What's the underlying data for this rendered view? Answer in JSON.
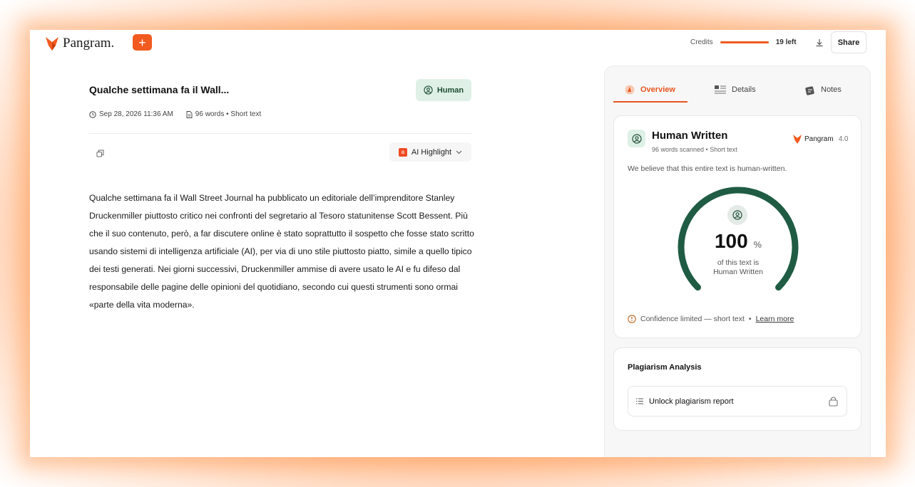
{
  "app": {
    "brand": "Pangram.",
    "new_label": "+",
    "credits_label": "Credits",
    "credits_remaining_text": "19 left",
    "credits_fraction": 1.0,
    "share_label": "Share",
    "accent": "#f25a1f"
  },
  "document": {
    "title": "Qualche settimana fa il Wall...",
    "badge": "Human",
    "date": "Sep 28, 2026 11:36 AM",
    "words": "96 words • Short text",
    "ai_highlight_label": "AI Highlight",
    "body": "Qualche settimana fa il Wall Street Journal ha pubblicato un editoriale dell’imprenditore Stanley Druckenmiller piuttosto critico nei confronti del segretario al Tesoro statunitense Scott Bessent. Più che il suo contenuto, però, a far discutere online è stato soprattutto il sospetto che fosse stato scritto usando sistemi di intelligenza artificiale (AI), per via di uno stile piuttosto piatto, simile a quello tipico dei testi generati. Nei giorni successivi, Druckenmiller ammise di avere usato le AI e fu difeso dal responsabile delle pagine delle opinioni del quotidiano, secondo cui questi strumenti sono ormai «parte della vita moderna»."
  },
  "panel": {
    "tabs": [
      {
        "label": "Overview",
        "active": true
      },
      {
        "label": "Details",
        "active": false
      },
      {
        "label": "Notes",
        "active": false
      }
    ],
    "result": {
      "title": "Human Written",
      "subtitle": "96 words scanned • Short text",
      "brand": "Pangram",
      "version": "4.0",
      "statement": "We believe that this entire text is human-written.",
      "percent": "100",
      "percent_unit": "%",
      "percent_caption_1": "of this text is",
      "percent_caption_2": "Human Written",
      "gauge_fraction": 1.0,
      "gauge_color": "#1f5c43",
      "confidence_text": "Confidence limited — short text",
      "confidence_sep": "•",
      "learn_more": "Learn more"
    },
    "plagiarism": {
      "title": "Plagiarism Analysis",
      "unlock_label": "Unlock plagiarism report"
    }
  }
}
